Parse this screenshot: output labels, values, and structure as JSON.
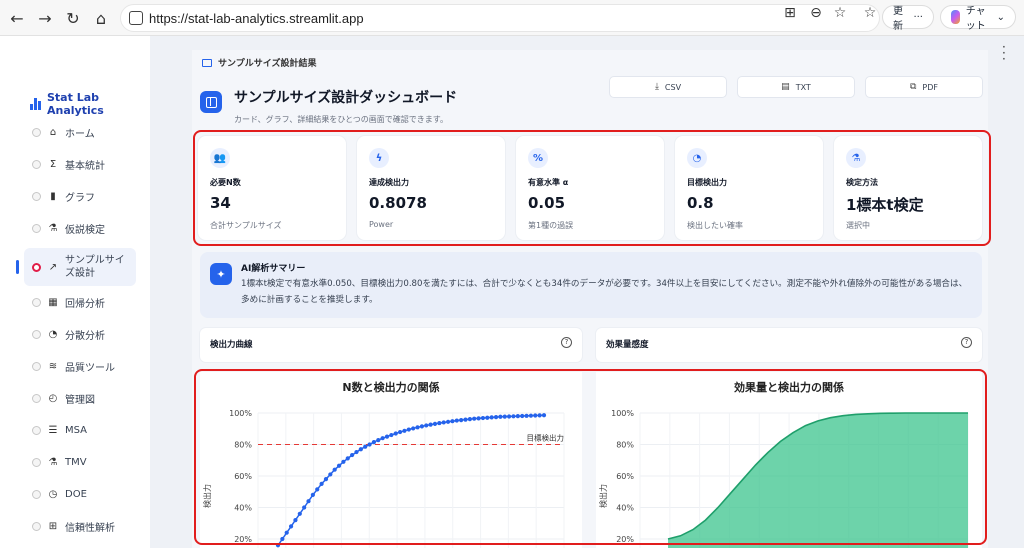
{
  "browser": {
    "url": "https://stat-lab-analytics.streamlit.app",
    "update_label": "更新",
    "more_label": "···",
    "copilot_label": "チャット"
  },
  "sidebar": {
    "brand": "Stat Lab Analytics",
    "items": [
      {
        "label": "ホーム",
        "icon": "home-icon",
        "glyph": "⌂"
      },
      {
        "label": "基本統計",
        "icon": "sigma-icon",
        "glyph": "Σ"
      },
      {
        "label": "グラフ",
        "icon": "bar-chart-icon",
        "glyph": "▮"
      },
      {
        "label": "仮説検定",
        "icon": "flask-icon",
        "glyph": "⚗"
      },
      {
        "label": "サンプルサイズ設計",
        "icon": "trend-icon",
        "glyph": "↗",
        "active": true
      },
      {
        "label": "回帰分析",
        "icon": "grid-icon",
        "glyph": "▦"
      },
      {
        "label": "分散分析",
        "icon": "gauge-icon",
        "glyph": "◔"
      },
      {
        "label": "品質ツール",
        "icon": "quality-chart-icon",
        "glyph": "≋"
      },
      {
        "label": "管理図",
        "icon": "control-chart-icon",
        "glyph": "◴"
      },
      {
        "label": "MSA",
        "icon": "sliders-icon",
        "glyph": "☰"
      },
      {
        "label": "TMV",
        "icon": "beaker-icon",
        "glyph": "⚗"
      },
      {
        "label": "DOE",
        "icon": "clock-icon",
        "glyph": "◷"
      },
      {
        "label": "信頼性解析",
        "icon": "reliability-icon",
        "glyph": "⊞"
      }
    ]
  },
  "section_label": "サンプルサイズ設計結果",
  "header": {
    "title": "サンプルサイズ設計ダッシュボード",
    "subtitle": "カード、グラフ、詳細結果をひとつの画面で確認できます。",
    "buttons": [
      "CSV",
      "TXT",
      "PDF"
    ]
  },
  "metrics": [
    {
      "label": "必要N数",
      "value": "34",
      "desc": "合計サンプルサイズ",
      "glyph": "👥"
    },
    {
      "label": "達成検出力",
      "value": "0.8078",
      "desc": "Power",
      "glyph": "ϟ"
    },
    {
      "label": "有意水準 α",
      "value": "0.05",
      "desc": "第1種の過誤",
      "glyph": "%"
    },
    {
      "label": "目標検出力",
      "value": "0.8",
      "desc": "検出したい確率",
      "glyph": "◔"
    },
    {
      "label": "検定方法",
      "value": "1標本t検定",
      "desc": "選択中",
      "glyph": "⚗"
    }
  ],
  "ai_summary": {
    "title": "AI解析サマリー",
    "line1": "1標本t検定で有意水準0.050、目標検出力0.80を満たすには、合計で少なくとも34件のデータが必要です。34件以上を目安にしてください。測定不能や外れ値除外の可能性がある場合は、",
    "line2": "多めに計画することを推奨します。"
  },
  "subcards": [
    {
      "title": "検出力曲線"
    },
    {
      "title": "効果量感度"
    }
  ],
  "colors": {
    "accent": "#2563eb",
    "highlight": "#e11d1d",
    "area": "#3cc48e"
  },
  "chart_data": [
    {
      "type": "line",
      "title": "N数と検出力の関係",
      "ylabel": "検出力",
      "y_ticks": [
        "100%",
        "80%",
        "60%",
        "40%",
        "20%"
      ],
      "ylim": [
        0.2,
        1.0
      ],
      "target_label": "目標検出力",
      "target_value": 0.8,
      "series": [
        {
          "values": [
            0.16,
            0.2,
            0.24,
            0.28,
            0.32,
            0.36,
            0.4,
            0.44,
            0.48,
            0.515,
            0.55,
            0.58,
            0.61,
            0.64,
            0.665,
            0.69,
            0.712,
            0.733,
            0.752,
            0.77,
            0.786,
            0.8,
            0.815,
            0.828,
            0.84,
            0.85,
            0.86,
            0.87,
            0.879,
            0.887,
            0.895,
            0.902,
            0.909,
            0.915,
            0.921,
            0.926,
            0.931,
            0.936,
            0.94,
            0.944,
            0.948,
            0.952,
            0.955,
            0.958,
            0.961,
            0.964,
            0.966,
            0.968,
            0.97,
            0.972,
            0.974,
            0.976,
            0.977,
            0.978,
            0.979,
            0.98,
            0.981,
            0.982,
            0.983,
            0.984,
            0.985,
            0.986
          ]
        }
      ]
    },
    {
      "type": "area",
      "title": "効果量と検出力の関係",
      "ylabel": "検出力",
      "y_ticks": [
        "100%",
        "80%",
        "60%",
        "40%",
        "20%"
      ],
      "ylim": [
        0.2,
        1.0
      ],
      "series": [
        {
          "values": [
            0.2,
            0.22,
            0.26,
            0.32,
            0.4,
            0.49,
            0.58,
            0.67,
            0.75,
            0.82,
            0.875,
            0.92,
            0.95,
            0.97,
            0.983,
            0.991,
            0.995,
            0.998,
            0.999,
            1.0,
            1.0,
            1.0,
            1.0,
            1.0,
            1.0
          ]
        }
      ]
    }
  ]
}
